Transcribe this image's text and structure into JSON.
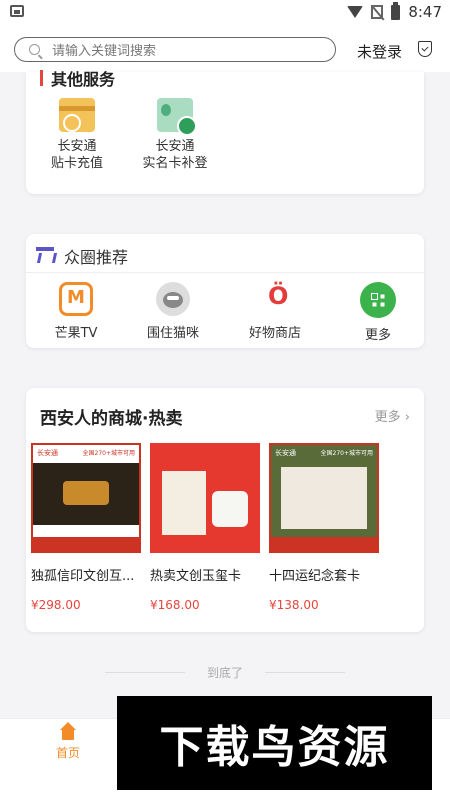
{
  "status": {
    "time": "8:47"
  },
  "header": {
    "search_placeholder": "请输入关键词搜索",
    "login": "未登录"
  },
  "services": {
    "title": "其他服务",
    "items": [
      {
        "label1": "长安通",
        "label2": "贴卡充值",
        "icon": "card-icon"
      },
      {
        "label1": "长安通",
        "label2": "实名卡补登",
        "icon": "id-card-check-icon"
      }
    ]
  },
  "circle": {
    "title": "众圈推荐",
    "apps": [
      {
        "label": "芒果TV",
        "icon": "mango-tv-icon"
      },
      {
        "label": "围住猫咪",
        "icon": "cat-icon"
      },
      {
        "label": "好物商店",
        "icon": "shop-icon"
      },
      {
        "label": "更多",
        "icon": "more-grid-icon"
      }
    ]
  },
  "mall": {
    "title": "西安人的商城·热卖",
    "more": "更多",
    "products": [
      {
        "name": "独孤信印文创互...",
        "price": "¥298.00",
        "badge": "长安通",
        "banner": "全国270+城市可用"
      },
      {
        "name": "热卖文创玉玺卡",
        "price": "¥168.00"
      },
      {
        "name": "十四运纪念套卡",
        "price": "¥138.00",
        "badge": "长安通",
        "banner": "全国270+城市可用"
      }
    ]
  },
  "footer_note": "到底了",
  "nav": {
    "home": "首页"
  },
  "watermark": "下载鸟资源",
  "colors": {
    "accent": "#f28c28",
    "price": "#e4473d",
    "more_green": "#3bb24b"
  }
}
